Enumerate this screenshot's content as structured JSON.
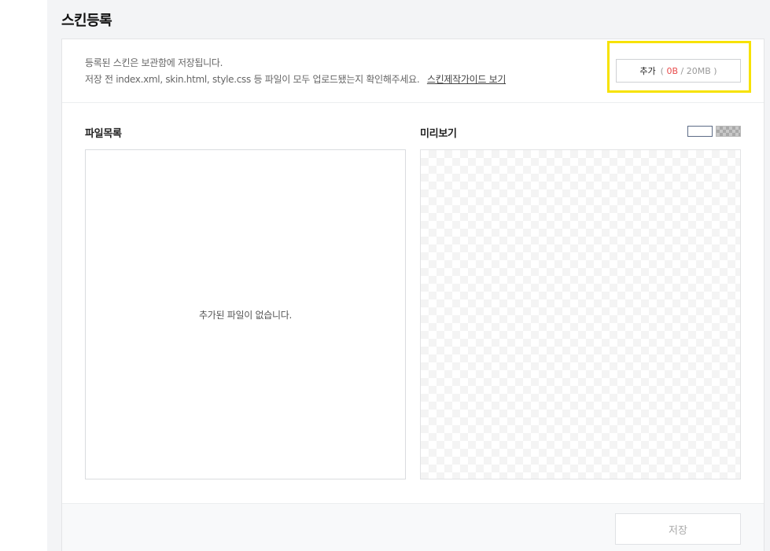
{
  "page": {
    "title": "스킨등록"
  },
  "header": {
    "description_line1": "등록된 스킨은 보관함에 저장됩니다.",
    "description_line2": "저장 전 index.xml, skin.html, style.css 등 파일이 모두 업로드됐는지 확인해주세요.",
    "guide_link": "스킨제작가이드 보기",
    "add_button": {
      "label": "추가",
      "paren_open": "(",
      "used": "0B",
      "separator": "/",
      "limit": "20MB",
      "paren_close": ")",
      "used_color": "#e84a4a"
    }
  },
  "file_list": {
    "label": "파일목록",
    "empty_message": "추가된 파일이 없습니다."
  },
  "preview": {
    "label": "미리보기",
    "background_options": [
      "white",
      "checker"
    ]
  },
  "footer": {
    "save_label": "저장"
  },
  "colors": {
    "highlight": "#f7e200",
    "accent_red": "#e84a4a",
    "page_bg": "#f3f4f6"
  }
}
